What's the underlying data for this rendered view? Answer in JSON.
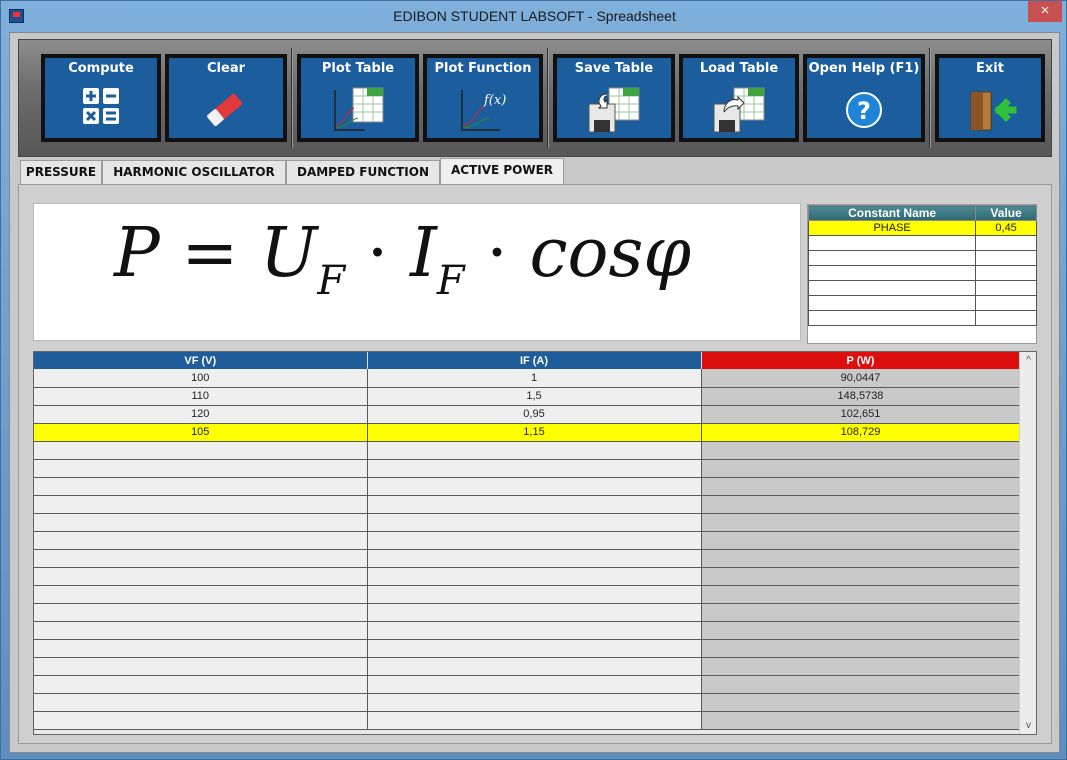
{
  "window": {
    "title": "EDIBON STUDENT LABSOFT - Spreadsheet",
    "close_glyph": "×"
  },
  "toolbar": [
    {
      "label": "Compute",
      "icon": "compute-icon"
    },
    {
      "label": "Clear",
      "icon": "eraser-icon"
    },
    {
      "label": "Plot Table",
      "icon": "plot-table-icon"
    },
    {
      "label": "Plot Function",
      "icon": "plot-function-icon",
      "icon_text": "f(x)"
    },
    {
      "label": "Save Table",
      "icon": "save-table-icon"
    },
    {
      "label": "Load Table",
      "icon": "load-table-icon"
    },
    {
      "label": "Open Help (F1)",
      "icon": "help-icon",
      "icon_text": "?"
    },
    {
      "label": "Exit",
      "icon": "exit-door-icon"
    }
  ],
  "tabs": [
    {
      "label": "PRESSURE",
      "active": false
    },
    {
      "label": "HARMONIC OSCILLATOR",
      "active": false
    },
    {
      "label": "DAMPED FUNCTION",
      "active": false
    },
    {
      "label": "ACTIVE POWER",
      "active": true
    }
  ],
  "formula": {
    "lhs": "P",
    "eq": "=",
    "u": "U",
    "u_sub": "F",
    "dot1": "·",
    "i": "I",
    "i_sub": "F",
    "dot2": "·",
    "cos": "cosφ"
  },
  "constants": {
    "headers": [
      "Constant Name",
      "Value"
    ],
    "rows": [
      [
        "PHASE",
        "0,45"
      ],
      [
        "",
        ""
      ],
      [
        "",
        ""
      ],
      [
        "",
        ""
      ],
      [
        "",
        ""
      ],
      [
        "",
        ""
      ],
      [
        "",
        ""
      ]
    ]
  },
  "grid": {
    "headers": [
      "VF (V)",
      "IF (A)",
      "P (W)"
    ],
    "rows": [
      [
        "100",
        "1",
        "90,0447"
      ],
      [
        "110",
        "1,5",
        "148,5738"
      ],
      [
        "120",
        "0,95",
        "102,651"
      ],
      [
        "105",
        "1,15",
        "108,729"
      ]
    ],
    "highlight_row": 3,
    "empty_rows": 16
  },
  "scroll": {
    "up": "^",
    "down": "v"
  },
  "colors": {
    "header_blue": "#1e5d99",
    "header_red": "#dd0e0e",
    "highlight": "#ffff00",
    "button_blue": "#1b5d9d"
  }
}
